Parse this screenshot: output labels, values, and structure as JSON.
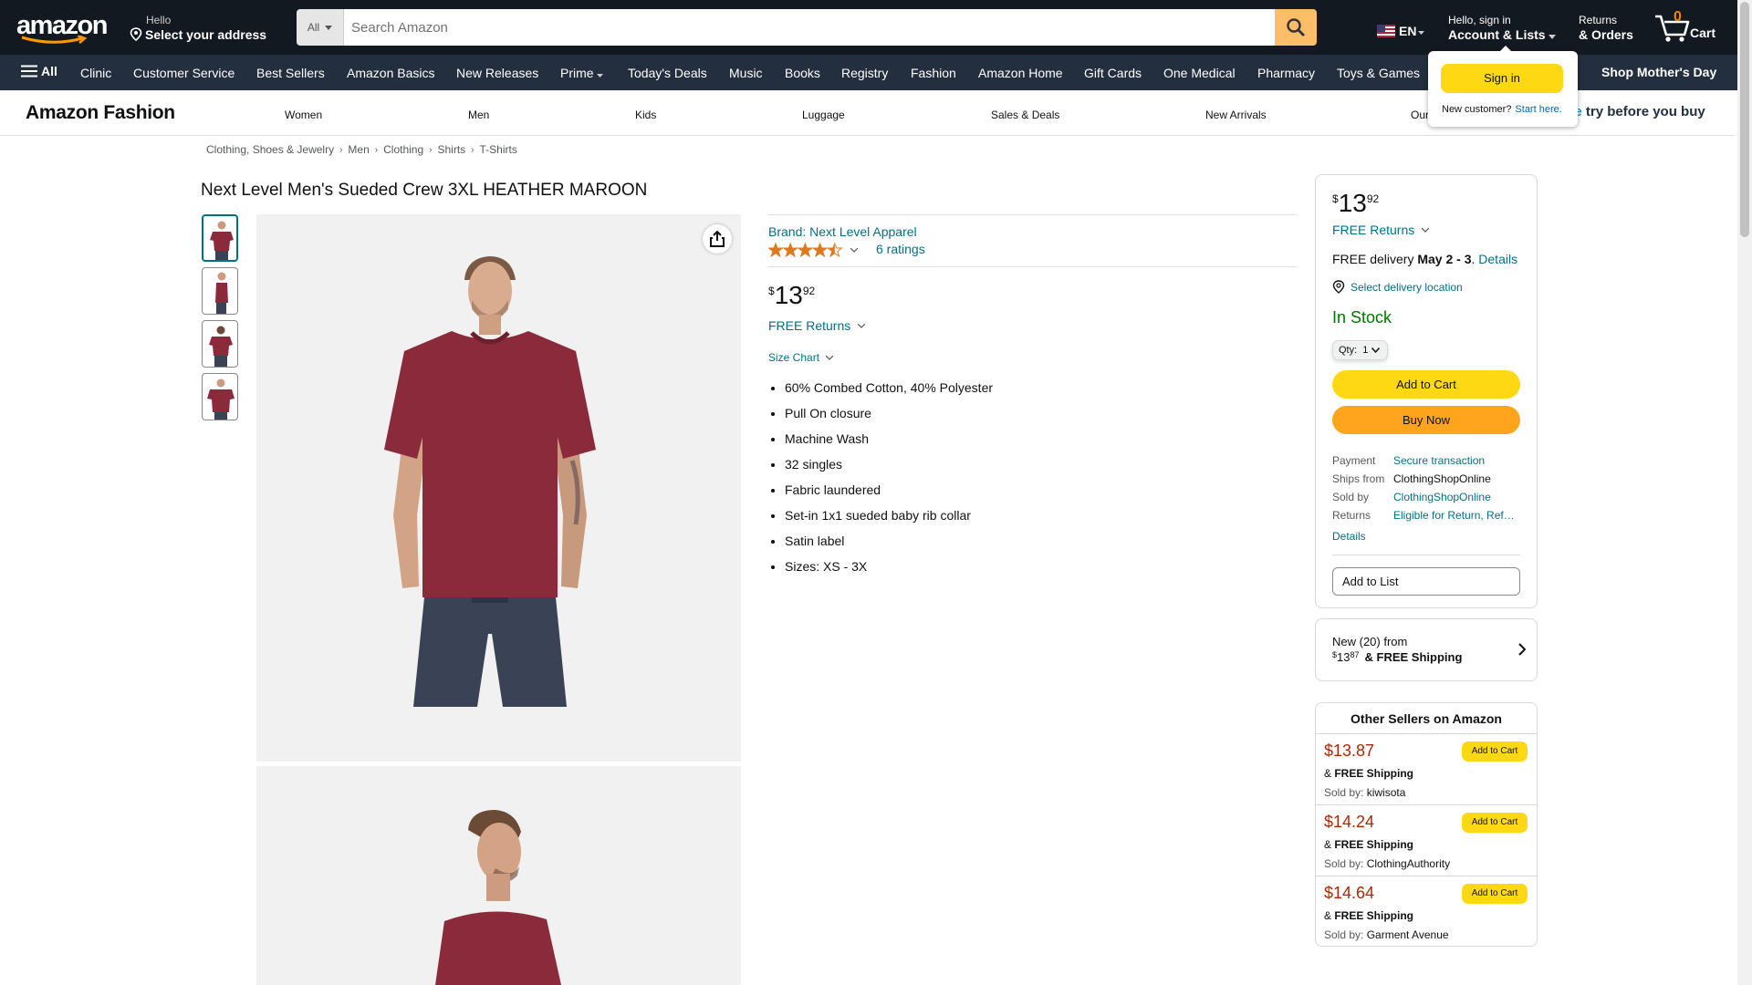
{
  "nav": {
    "logo_text": "amazon",
    "address_line1": "Hello",
    "address_line2": "Select your address",
    "search_category": "All",
    "search_placeholder": "Search Amazon",
    "language": "EN",
    "account_line1": "Hello, sign in",
    "account_line2": "Account & Lists",
    "orders_line1": "Returns",
    "orders_line2": "& Orders",
    "cart_count": "0",
    "cart_label": "Cart"
  },
  "subnav": {
    "all_label": "All",
    "items": [
      "Clinic",
      "Customer Service",
      "Best Sellers",
      "Amazon Basics",
      "New Releases",
      "Prime",
      "Today's Deals",
      "Music",
      "Books",
      "Registry",
      "Fashion",
      "Amazon Home",
      "Gift Cards",
      "One Medical",
      "Pharmacy",
      "Toys & Games"
    ],
    "promo": "Shop Mother's Day"
  },
  "fashion_bar": {
    "brand": "Amazon Fashion",
    "tabs": [
      "Women",
      "Men",
      "Kids",
      "Luggage",
      "Sales & Deals",
      "New Arrivals",
      "Our"
    ],
    "promo_prefix": "me",
    "promo_text": " try before you buy"
  },
  "signin_popover": {
    "button": "Sign in",
    "new_customer": "New customer?",
    "start_here": "Start here."
  },
  "breadcrumb": [
    "Clothing, Shoes & Jewelry",
    "Men",
    "Clothing",
    "Shirts",
    "T-Shirts"
  ],
  "product": {
    "title": "Next Level Men's Sueded Crew 3XL HEATHER MAROON",
    "brand_link": "Brand: Next Level Apparel",
    "rating": 4.5,
    "ratings_count": "6 ratings",
    "price_symbol": "$",
    "price_whole": "13",
    "price_fraction": "92",
    "free_returns": "FREE Returns",
    "size_chart": "Size Chart",
    "bullets": [
      "60% Combed Cotton, 40% Polyester",
      "Pull On closure",
      "Machine Wash",
      "32 singles",
      "Fabric laundered",
      "Set-in 1x1 sueded baby rib collar",
      "Satin label",
      "Sizes: XS - 3X"
    ],
    "shirt_color": "#8b2a3a"
  },
  "buybox": {
    "price_symbol": "$",
    "price_whole": "13",
    "price_fraction": "92",
    "free_returns": "FREE Returns",
    "delivery_prefix": "FREE delivery",
    "delivery_date": "May 2 - 3",
    "delivery_details": "Details",
    "location": "Select delivery location",
    "stock": "In Stock",
    "qty_label": "Qty:",
    "qty_value": "1",
    "add_to_cart": "Add to Cart",
    "buy_now": "Buy Now",
    "details": [
      {
        "k": "Payment",
        "v": "Secure transaction",
        "link": true
      },
      {
        "k": "Ships from",
        "v": "ClothingShopOnline",
        "link": false
      },
      {
        "k": "Sold by",
        "v": "ClothingShopOnline",
        "link": true
      },
      {
        "k": "Returns",
        "v": "Eligible for Return, Refund or Replacement",
        "link": true
      }
    ],
    "more_details": "Details",
    "add_to_list": "Add to List"
  },
  "new_offers": {
    "line1": "New (20) from",
    "price_symbol": "$",
    "price_whole": "13",
    "price_fraction": "87",
    "shipping": "& FREE Shipping"
  },
  "other_sellers": {
    "header": "Other Sellers on Amazon",
    "offers": [
      {
        "price": "$13.87",
        "add": "Add to Cart",
        "ship_prefix": "& ",
        "ship": "FREE Shipping",
        "sold_label": "Sold by: ",
        "seller": "kiwisota"
      },
      {
        "price": "$14.24",
        "add": "Add to Cart",
        "ship_prefix": "& ",
        "ship": "FREE Shipping",
        "sold_label": "Sold by: ",
        "seller": "ClothingAuthority"
      },
      {
        "price": "$14.64",
        "add": "Add to Cart",
        "ship_prefix": "& ",
        "ship": "FREE Shipping",
        "sold_label": "Sold by: ",
        "seller": "Garment Avenue"
      }
    ]
  }
}
